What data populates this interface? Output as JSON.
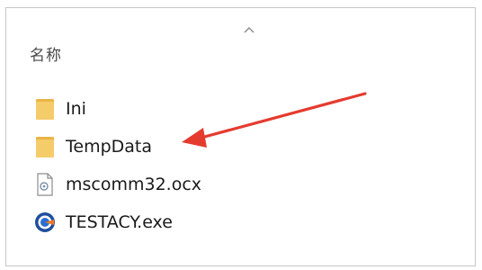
{
  "column": {
    "name_header": "名称"
  },
  "files": [
    {
      "name": "Ini",
      "icon": "folder-icon"
    },
    {
      "name": "TempData",
      "icon": "folder-icon"
    },
    {
      "name": "mscomm32.ocx",
      "icon": "ocx-file-icon"
    },
    {
      "name": "TESTACY.exe",
      "icon": "exe-app-icon"
    }
  ],
  "colors": {
    "folder": "#f2c45a",
    "annotation_arrow": "#e53b2f"
  }
}
